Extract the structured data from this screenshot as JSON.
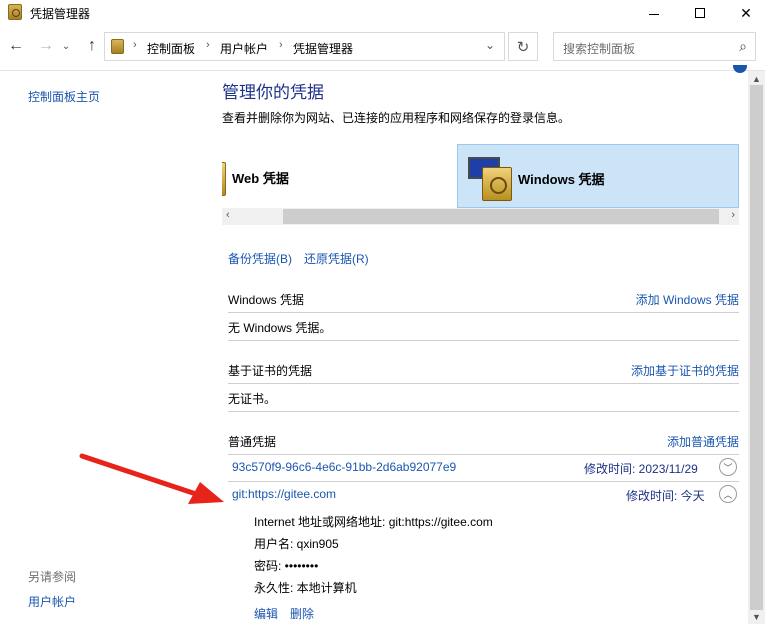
{
  "window": {
    "title": "凭据管理器",
    "min_glyph": "",
    "max_glyph": "",
    "close_glyph": "✕"
  },
  "address": {
    "crumbs": [
      "控制面板",
      "用户帐户",
      "凭据管理器"
    ],
    "search_placeholder": "搜索控制面板"
  },
  "leftnav": {
    "home": "控制面板主页",
    "see_also": "另请参阅",
    "user_accounts": "用户帐户"
  },
  "main": {
    "heading": "管理你的凭据",
    "subheading": "查看并删除你为网站、已连接的应用程序和网络保存的登录信息。",
    "tabs": [
      {
        "label": "Web 凭据",
        "selected": false
      },
      {
        "label": "Windows 凭据",
        "selected": true
      }
    ],
    "backup_link": "备份凭据(B)",
    "restore_link": "还原凭据(R)",
    "sections": {
      "windows": {
        "title": "Windows 凭据",
        "action": "添加 Windows 凭据",
        "body": "无 Windows 凭据。"
      },
      "cert": {
        "title": "基于证书的凭据",
        "action": "添加基于证书的凭据",
        "body": "无证书。"
      },
      "generic": {
        "title": "普通凭据",
        "action": "添加普通凭据"
      }
    },
    "generic_creds": [
      {
        "name": "93c570f9-96c6-4e6c-91bb-2d6ab92077e9",
        "modified": "修改时间:  2023/11/29",
        "expanded": false
      },
      {
        "name": "git:https://gitee.com",
        "modified": "修改时间:  今天",
        "expanded": true
      }
    ],
    "details": {
      "address": "Internet 地址或网络地址:  git:https://gitee.com",
      "username": "用户名:  qxin905",
      "password": "密码:  ••••••••",
      "persistence": "永久性:  本地计算机",
      "edit": "编辑",
      "delete": "删除"
    }
  },
  "colors": {
    "link": "#1a56b0",
    "heading": "#1e3287",
    "selected_tab": "#cce4f7",
    "annotation_arrow": "#e8231a"
  }
}
